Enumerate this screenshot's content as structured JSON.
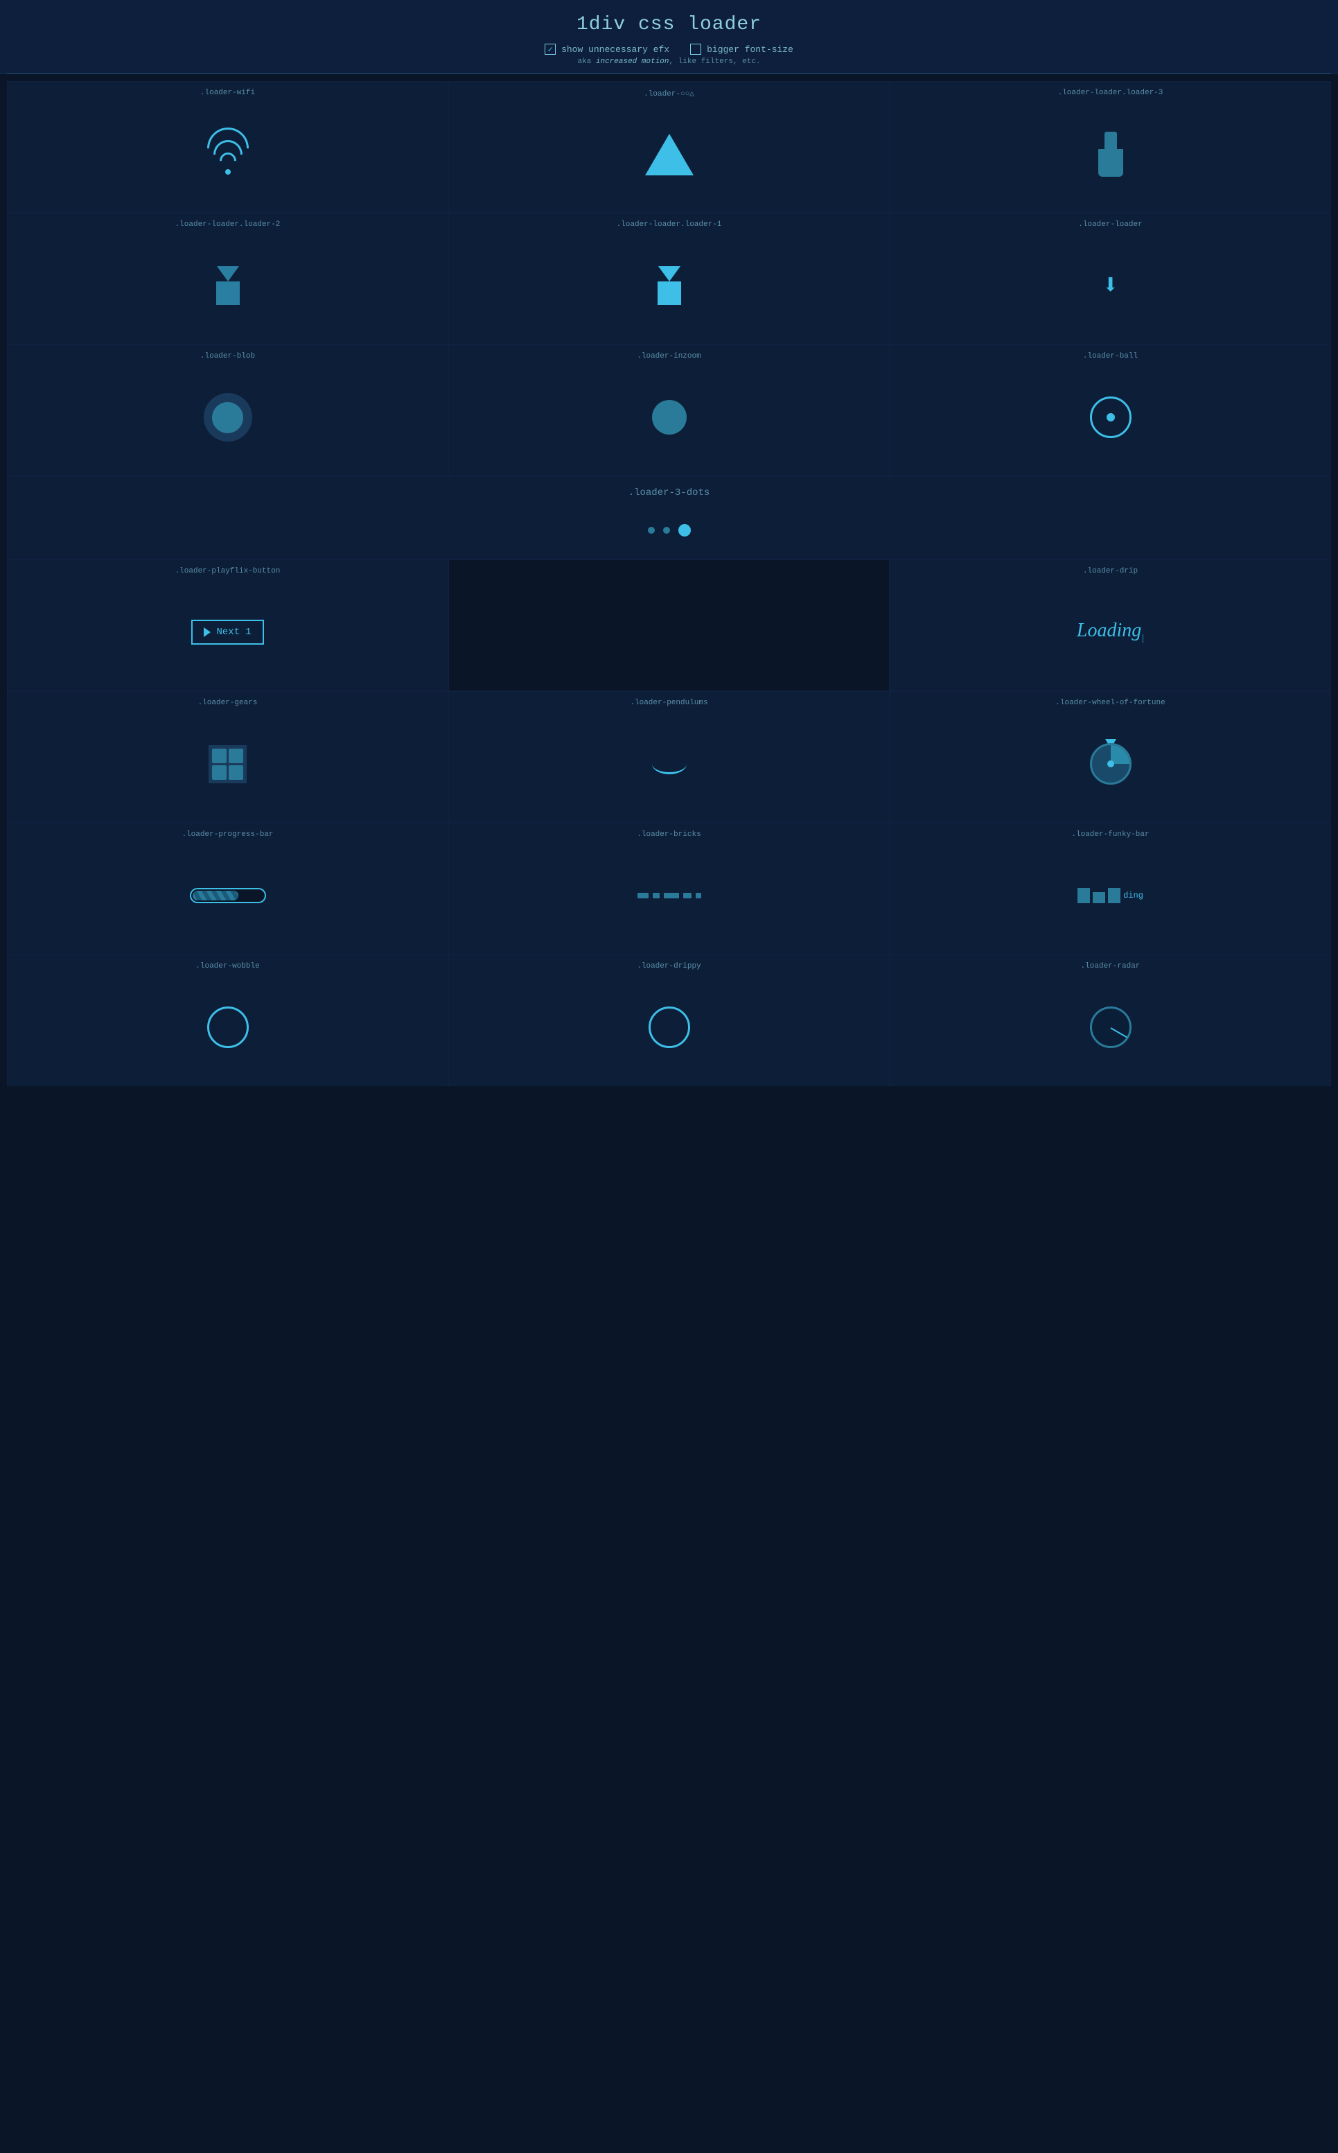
{
  "header": {
    "title": "1div css loader",
    "show_efx_label": "show unnecessary efx",
    "show_efx_checked": true,
    "subtext": "aka ",
    "subtext_em": "increased motion",
    "subtext_rest": ", like filters, etc.",
    "bigger_font_label": "bigger font-size",
    "bigger_font_checked": false
  },
  "loaders": [
    {
      "id": "loader-wifi",
      "name": ".loader-wifi",
      "type": "wifi"
    },
    {
      "id": "loader-triangle",
      "name": ".loader-○○△",
      "type": "triangle"
    },
    {
      "id": "loader-loader3",
      "name": ".loader-loader.loader-3",
      "type": "bottle"
    },
    {
      "id": "loader-loader2",
      "name": ".loader-loader.loader-2",
      "type": "arrow-box-fade"
    },
    {
      "id": "loader-loader1",
      "name": ".loader-loader.loader-1",
      "type": "arrow-box"
    },
    {
      "id": "loader-loader",
      "name": ".loader-loader",
      "type": "simple-arrow"
    },
    {
      "id": "loader-blob",
      "name": ".loader-blob",
      "type": "blob"
    },
    {
      "id": "loader-inzoom",
      "name": ".loader-inzoom",
      "type": "inzoom"
    },
    {
      "id": "loader-ball",
      "name": ".loader-ball",
      "type": "ball"
    },
    {
      "id": "loader-playflix",
      "name": ".loader-playflix-button",
      "type": "playflix",
      "btn_text": "Next",
      "btn_num": "1"
    },
    {
      "id": "loader-3dots",
      "name": ".loader-3-dots",
      "type": "three-dots",
      "wide": true
    },
    {
      "id": "loader-drip",
      "name": ".loader-drip",
      "type": "drip-text",
      "text": "Loading"
    },
    {
      "id": "loader-gears",
      "name": ".loader-gears",
      "type": "gears"
    },
    {
      "id": "loader-pendulums",
      "name": ".loader-pendulums",
      "type": "pendulum"
    },
    {
      "id": "loader-wheel",
      "name": ".loader-wheel-of-fortune",
      "type": "wheel"
    },
    {
      "id": "loader-progress",
      "name": ".loader-progress-bar",
      "type": "progress"
    },
    {
      "id": "loader-bricks",
      "name": ".loader-bricks",
      "type": "bricks"
    },
    {
      "id": "loader-funky",
      "name": ".loader-funky-bar",
      "type": "funky"
    },
    {
      "id": "loader-wobble",
      "name": ".loader-wobble",
      "type": "wobble"
    },
    {
      "id": "loader-drippy",
      "name": ".loader-drippy",
      "type": "drippy"
    },
    {
      "id": "loader-radar",
      "name": ".loader-radar",
      "type": "radar"
    }
  ]
}
